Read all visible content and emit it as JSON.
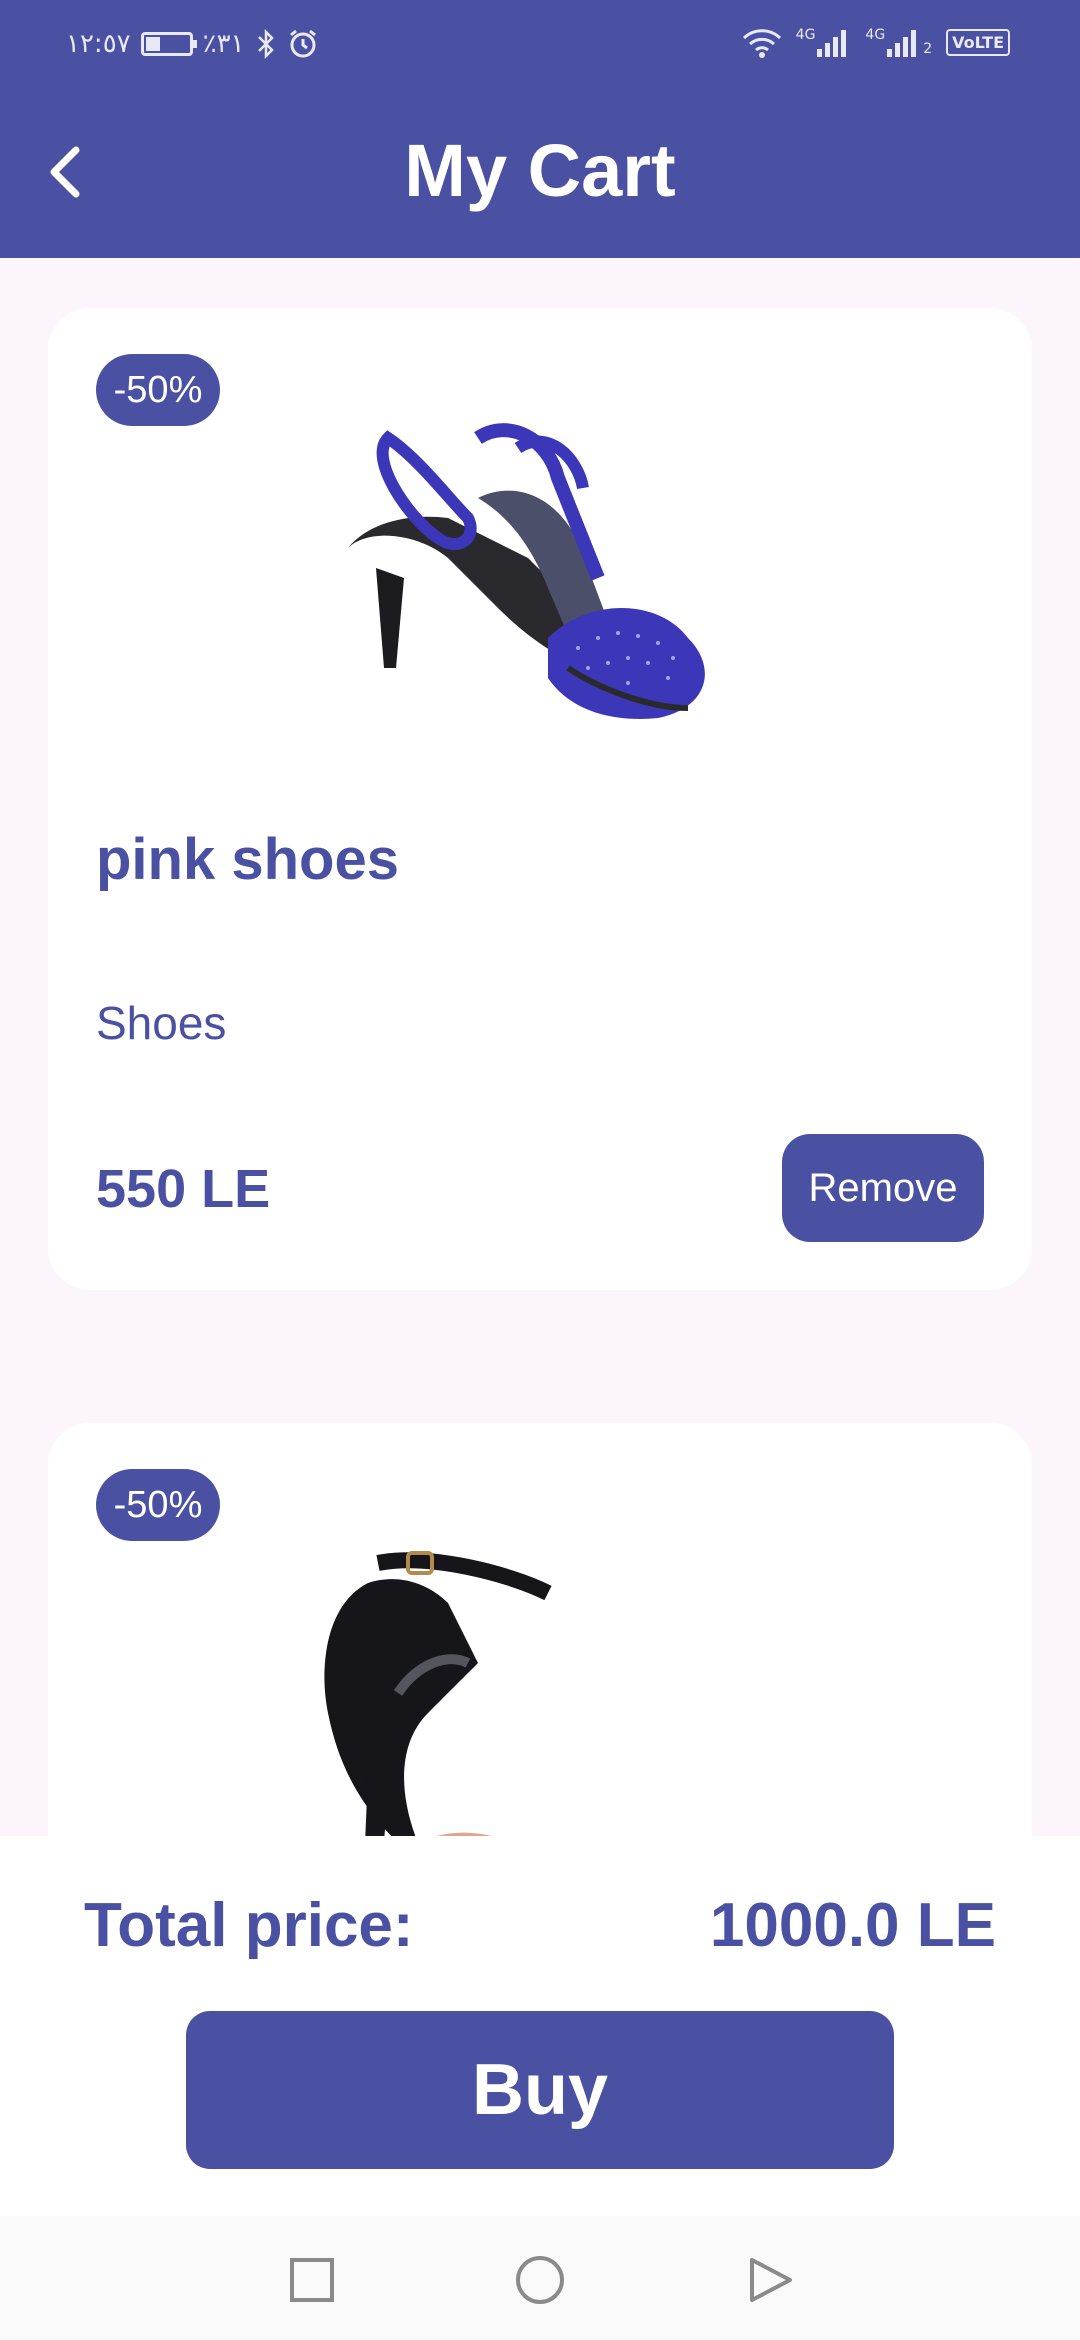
{
  "status_bar": {
    "time": "١٢:٥٧",
    "battery": "٪٣١",
    "icons": [
      "battery-icon",
      "bluetooth-icon",
      "alarm-icon",
      "wifi-icon",
      "signal-icon",
      "signal-icon"
    ],
    "network_1": "4G",
    "network_2": "4G",
    "sim_slot": "2",
    "volte": "VoLTE"
  },
  "app_bar": {
    "title": "My Cart",
    "back_icon": "back-arrow-icon"
  },
  "cart_items": [
    {
      "discount_badge": "-50%",
      "name": "pink shoes",
      "category": "Shoes",
      "price": "550 LE",
      "remove_label": "Remove",
      "image": "blue-polka-dot-heel-sandal"
    },
    {
      "discount_badge": "-50%",
      "image": "black-patent-ankle-strap-heel"
    }
  ],
  "footer": {
    "total_label": "Total price:",
    "total_value": "1000.0 LE",
    "buy_label": "Buy"
  },
  "nav_bar": {
    "icons": [
      "recent-apps-icon",
      "home-icon",
      "back-icon"
    ]
  },
  "colors": {
    "primary": "#4a51a3",
    "background": "#fcf5fc",
    "card": "#ffffff"
  }
}
